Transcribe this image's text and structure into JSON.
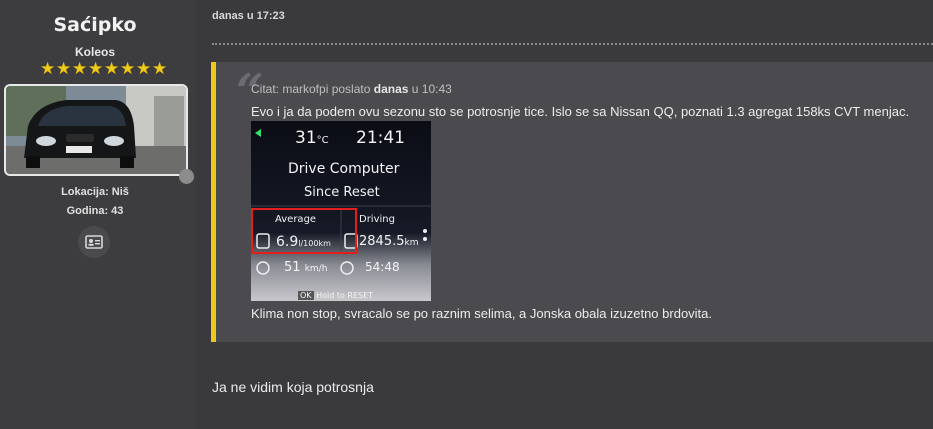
{
  "user": {
    "name": "Saćipko",
    "title": "Koleos",
    "stars": 8,
    "location_label": "Lokacija: Niš",
    "years_label": "Godina: 43",
    "avatar_icon": "car-photo",
    "contact_icon": "id-card-icon"
  },
  "post": {
    "date": "danas u 17:23",
    "quote": {
      "cite_prefix": "Citat: markofpi poslato",
      "cite_day": "danas",
      "cite_time": "u 10:43",
      "text_before": "Evo i ja da podem ovu sezonu sto se potrosnje tice. Islo se sa Nissan QQ, poznati 1.3  agregat 158ks CVT menjac.",
      "text_after": "Klima non stop, svracalo se po raznim selima, a Jonska obala izuzetno brdovita.",
      "image": {
        "temp": "31",
        "temp_unit": "°C",
        "clock": "21:41",
        "title": "Drive Computer",
        "subtitle": "Since Reset",
        "average_label": "Average",
        "average_value": "6.9",
        "average_unit": "l/100km",
        "driving_label": "Driving",
        "driving_value": "2845.5",
        "driving_unit": "km",
        "speed_value": "51",
        "speed_unit": "km/h",
        "time_value": "54:48",
        "hint": "Hold to RESET",
        "hint_key": "OK"
      }
    },
    "reply": "Ja ne vidim koja potrosnja"
  },
  "colors": {
    "accent": "#f0c81a",
    "background": "#3a3a3d",
    "quote_bg": "#4b4b4f",
    "highlight_box": "#e41d1d"
  }
}
